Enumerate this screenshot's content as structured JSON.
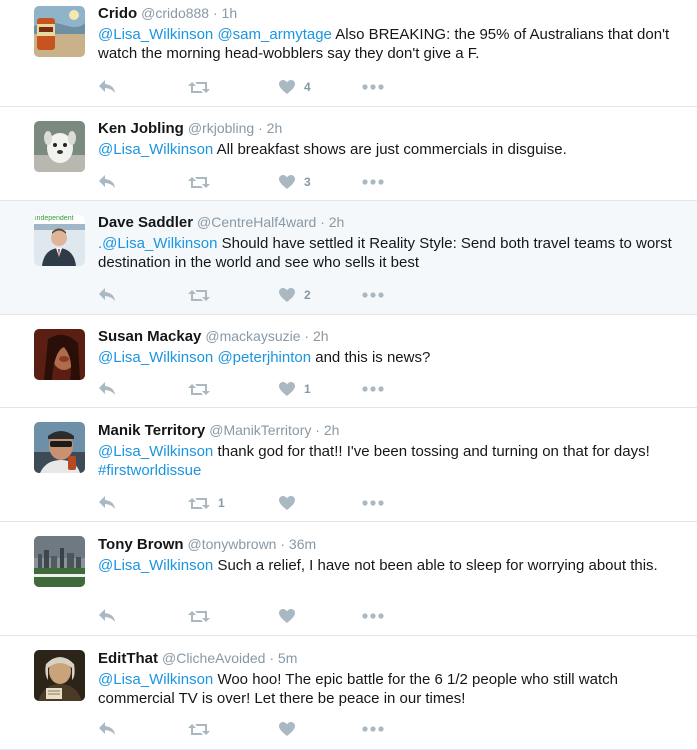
{
  "tweets": [
    {
      "name": "Crido",
      "handle": "@crido888",
      "time": "1h",
      "text_parts": [
        {
          "t": "@Lisa_Wilkinson",
          "link": true
        },
        {
          "t": " ",
          "link": false
        },
        {
          "t": "@sam_armytage",
          "link": true
        },
        {
          "t": " Also BREAKING: the 95% of Australians that don't watch the morning head-wobblers say they don't give a F.",
          "link": false
        }
      ],
      "retweets": "",
      "likes": "4",
      "highlight": false
    },
    {
      "name": "Ken Jobling",
      "handle": "@rkjobling",
      "time": "2h",
      "text_parts": [
        {
          "t": "@Lisa_Wilkinson",
          "link": true
        },
        {
          "t": " All breakfast shows are just commercials in disguise.",
          "link": false
        }
      ],
      "retweets": "",
      "likes": "3",
      "highlight": false
    },
    {
      "name": "Dave Saddler",
      "handle": "@CentreHalf4ward",
      "time": "2h",
      "avatar_caption": "independent",
      "text_parts": [
        {
          "t": ".@Lisa_Wilkinson",
          "link": true
        },
        {
          "t": " Should have settled it Reality Style: Send both travel teams to worst destination in the world and see who sells it best",
          "link": false
        }
      ],
      "retweets": "",
      "likes": "2",
      "highlight": true
    },
    {
      "name": "Susan Mackay",
      "handle": "@mackaysuzie",
      "time": "2h",
      "text_parts": [
        {
          "t": "@Lisa_Wilkinson",
          "link": true
        },
        {
          "t": " ",
          "link": false
        },
        {
          "t": "@peterjhinton",
          "link": true
        },
        {
          "t": " and this is news?",
          "link": false
        }
      ],
      "retweets": "",
      "likes": "1",
      "highlight": false
    },
    {
      "name": "Manik Territory",
      "handle": "@ManikTerritory",
      "time": "2h",
      "text_parts": [
        {
          "t": "@Lisa_Wilkinson",
          "link": true
        },
        {
          "t": " thank god for that!! I've been tossing and turning on that for days! ",
          "link": false
        },
        {
          "t": "#firstworldissue",
          "link": true
        }
      ],
      "retweets": "1",
      "likes": "",
      "highlight": false
    },
    {
      "name": "Tony Brown",
      "handle": "@tonywbrown",
      "time": "36m",
      "text_parts": [
        {
          "t": "@Lisa_Wilkinson",
          "link": true
        },
        {
          "t": " Such a relief, I have not been able to sleep for worrying about this.",
          "link": false
        }
      ],
      "retweets": "",
      "likes": "",
      "highlight": false
    },
    {
      "name": "EditThat",
      "handle": "@ClicheAvoided",
      "time": "5m",
      "text_parts": [
        {
          "t": "@Lisa_Wilkinson",
          "link": true
        },
        {
          "t": " Woo hoo! The epic battle for the 6 1/2 people who still watch commercial TV is over! Let there be peace in our times!",
          "link": false
        }
      ],
      "retweets": "",
      "likes": "",
      "highlight": false
    }
  ],
  "separator": " · ",
  "icons": {
    "reply": "reply-icon",
    "retweet": "retweet-icon",
    "like": "heart-icon",
    "more": "more-icon"
  },
  "colors": {
    "link": "#1b95e0",
    "secondary": "#8899a6",
    "icon": "#aab8c2",
    "highlight_bg": "#f5f8fa",
    "divider": "#e1e8ed"
  }
}
